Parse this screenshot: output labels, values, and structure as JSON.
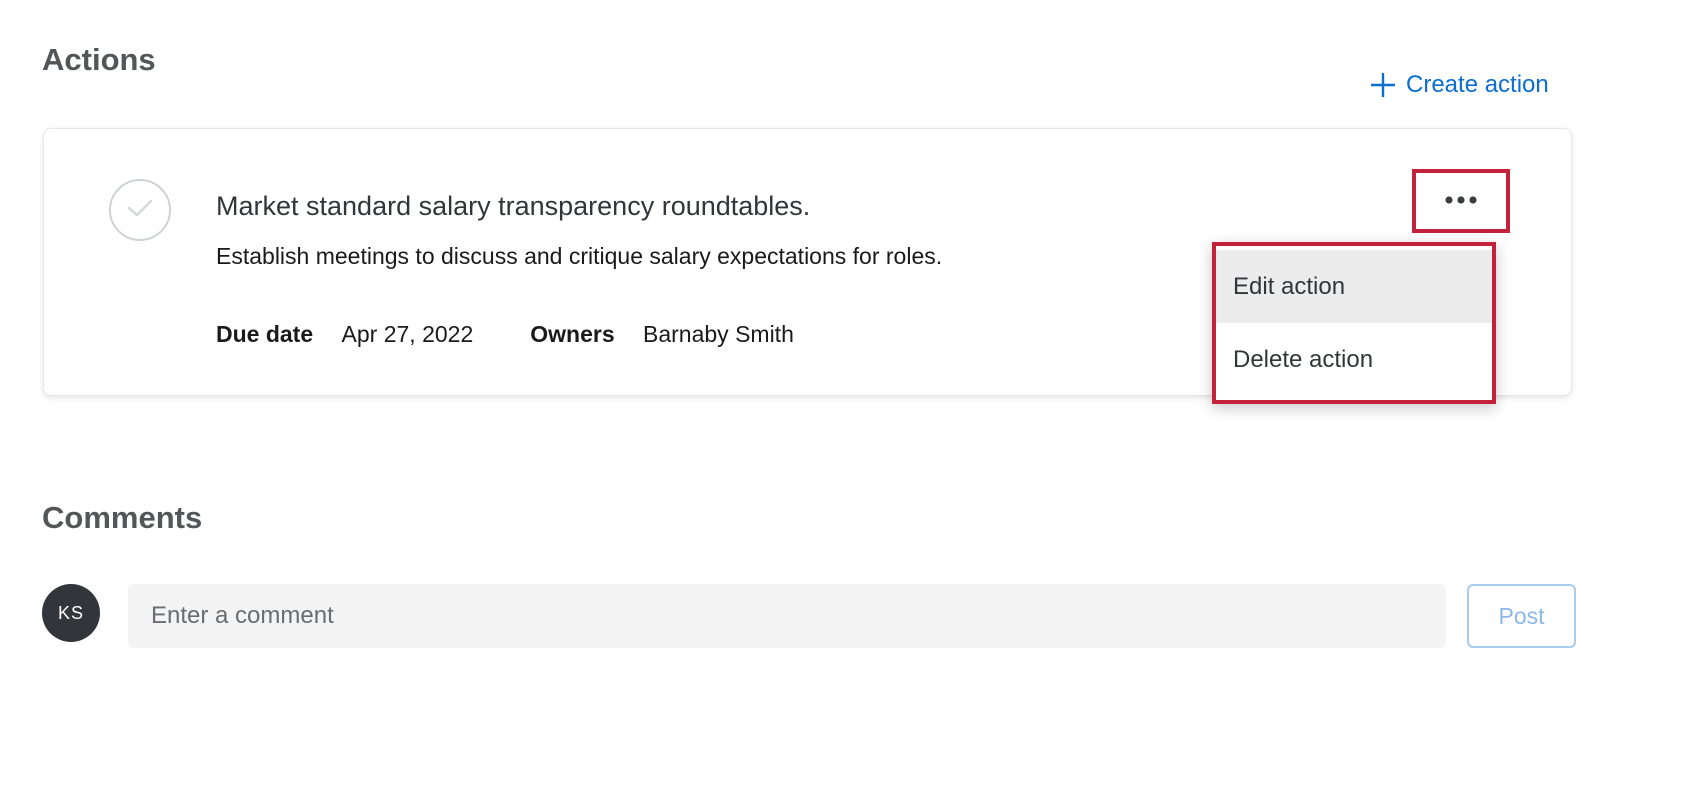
{
  "actions_section": {
    "title": "Actions",
    "create_action_label": "Create action"
  },
  "action_card": {
    "title": "Market standard salary transparency roundtables.",
    "description": "Establish meetings to discuss and critique salary expectations for roles.",
    "due_date_label": "Due date",
    "due_date_value": "Apr 27, 2022",
    "owners_label": "Owners",
    "owners_value": "Barnaby Smith",
    "icons": {
      "complete": "checkmark-circle-icon",
      "more": "ellipsis-horizontal-icon"
    }
  },
  "action_menu": {
    "items": [
      {
        "label": "Edit action",
        "highlighted": true
      },
      {
        "label": "Delete action",
        "highlighted": false
      }
    ],
    "highlight_color": "#c4213a"
  },
  "comments_section": {
    "title": "Comments",
    "avatar_initials": "KS",
    "input_placeholder": "Enter a comment",
    "input_value": "",
    "post_label": "Post"
  },
  "colors": {
    "accent": "#0b6ed0",
    "heading": "#525659",
    "avatar_bg": "#32363a",
    "post_disabled": "#8bb8e8"
  }
}
